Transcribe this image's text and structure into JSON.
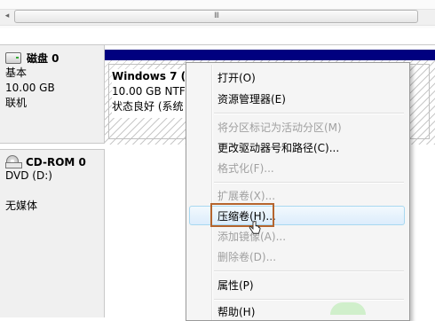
{
  "scrollbar": {
    "grip_glyph": "III",
    "left_arrow_glyph": "◂"
  },
  "disks": [
    {
      "icon": "hard-disk-icon",
      "name": "磁盘 0",
      "lines": [
        "基本",
        "10.00 GB",
        "联机"
      ]
    },
    {
      "icon": "cd-rom-icon",
      "name": "CD-ROM 0",
      "lines": [
        "DVD (D:)",
        "",
        "无媒体"
      ]
    }
  ],
  "partition": {
    "name": "Windows 7  (",
    "size": "10.00 GB NTF",
    "status": "状态良好 (系统"
  },
  "context_menu": {
    "items": [
      {
        "label": "打开(O)",
        "enabled": true
      },
      {
        "label": "资源管理器(E)",
        "enabled": true
      },
      {
        "label": "将分区标记为活动分区(M)",
        "enabled": false
      },
      {
        "label": "更改驱动器号和路径(C)...",
        "enabled": true
      },
      {
        "label": "格式化(F)...",
        "enabled": false
      },
      {
        "label": "扩展卷(X)...",
        "enabled": false
      },
      {
        "label": "压缩卷(H)...",
        "enabled": true,
        "highlighted": true
      },
      {
        "label": "添加镜像(A)...",
        "enabled": false
      },
      {
        "label": "删除卷(D)...",
        "enabled": false
      },
      {
        "label": "属性(P)",
        "enabled": true
      },
      {
        "label": "帮助(H)",
        "enabled": true
      }
    ],
    "highlight_color": "#b5652e"
  },
  "colors": {
    "partition_header": "#00007f"
  }
}
